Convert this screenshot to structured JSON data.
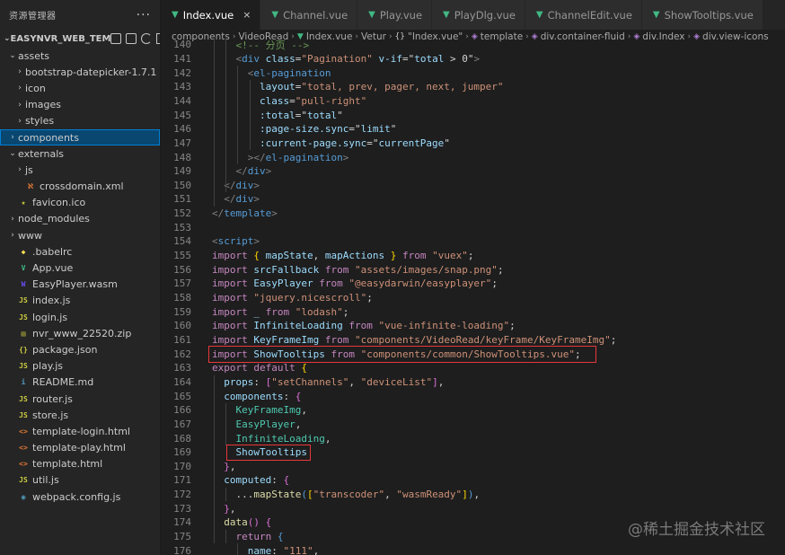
{
  "sidebar": {
    "title": "资源管理器",
    "more": "···",
    "project": "EASYNVR_WEB_TEM",
    "items": [
      {
        "label": "assets",
        "arrow": "⌄",
        "type": "folder-open",
        "indent": 1,
        "selected": false
      },
      {
        "label": "bootstrap-datepicker-1.7.1",
        "arrow": "›",
        "type": "folder",
        "indent": 2,
        "selected": false
      },
      {
        "label": "icon",
        "arrow": "›",
        "type": "folder",
        "indent": 2,
        "selected": false
      },
      {
        "label": "images",
        "arrow": "›",
        "type": "folder",
        "indent": 2,
        "selected": false
      },
      {
        "label": "styles",
        "arrow": "›",
        "type": "folder",
        "indent": 2,
        "selected": false
      },
      {
        "label": "components",
        "arrow": "›",
        "type": "folder",
        "indent": 1,
        "selected": true
      },
      {
        "label": "externals",
        "arrow": "⌄",
        "type": "folder-open",
        "indent": 1,
        "selected": false
      },
      {
        "label": "js",
        "arrow": "›",
        "type": "folder",
        "indent": 2,
        "selected": false
      },
      {
        "label": "crossdomain.xml",
        "arrow": "",
        "type": "xml",
        "indent": 2,
        "selected": false
      },
      {
        "label": "favicon.ico",
        "arrow": "",
        "type": "ico",
        "indent": 1,
        "selected": false
      },
      {
        "label": "node_modules",
        "arrow": "›",
        "type": "folder",
        "indent": 1,
        "selected": false
      },
      {
        "label": "www",
        "arrow": "›",
        "type": "folder",
        "indent": 1,
        "selected": false
      },
      {
        "label": ".babelrc",
        "arrow": "",
        "type": "babel",
        "indent": 1,
        "selected": false
      },
      {
        "label": "App.vue",
        "arrow": "",
        "type": "vue",
        "indent": 1,
        "selected": false
      },
      {
        "label": "EasyPlayer.wasm",
        "arrow": "",
        "type": "wasm",
        "indent": 1,
        "selected": false
      },
      {
        "label": "index.js",
        "arrow": "",
        "type": "js",
        "indent": 1,
        "selected": false
      },
      {
        "label": "login.js",
        "arrow": "",
        "type": "js",
        "indent": 1,
        "selected": false
      },
      {
        "label": "nvr_www_22520.zip",
        "arrow": "",
        "type": "zip",
        "indent": 1,
        "selected": false
      },
      {
        "label": "package.json",
        "arrow": "",
        "type": "json",
        "indent": 1,
        "selected": false
      },
      {
        "label": "play.js",
        "arrow": "",
        "type": "js",
        "indent": 1,
        "selected": false
      },
      {
        "label": "README.md",
        "arrow": "",
        "type": "md",
        "indent": 1,
        "selected": false
      },
      {
        "label": "router.js",
        "arrow": "",
        "type": "js",
        "indent": 1,
        "selected": false
      },
      {
        "label": "store.js",
        "arrow": "",
        "type": "js",
        "indent": 1,
        "selected": false
      },
      {
        "label": "template-login.html",
        "arrow": "",
        "type": "html",
        "indent": 1,
        "selected": false
      },
      {
        "label": "template-play.html",
        "arrow": "",
        "type": "html",
        "indent": 1,
        "selected": false
      },
      {
        "label": "template.html",
        "arrow": "",
        "type": "html",
        "indent": 1,
        "selected": false
      },
      {
        "label": "util.js",
        "arrow": "",
        "type": "js",
        "indent": 1,
        "selected": false
      },
      {
        "label": "webpack.config.js",
        "arrow": "",
        "type": "webpack",
        "indent": 1,
        "selected": false
      }
    ]
  },
  "tabs": [
    {
      "label": "Index.vue",
      "active": true,
      "close": "×"
    },
    {
      "label": "Channel.vue",
      "active": false,
      "close": ""
    },
    {
      "label": "Play.vue",
      "active": false,
      "close": ""
    },
    {
      "label": "PlayDlg.vue",
      "active": false,
      "close": ""
    },
    {
      "label": "ChannelEdit.vue",
      "active": false,
      "close": ""
    },
    {
      "label": "ShowTooltips.vue",
      "active": false,
      "close": ""
    }
  ],
  "breadcrumb": [
    "components",
    "VideoRead",
    "Index.vue",
    "Vetur",
    "\"Index.vue\"",
    "template",
    "div.container-fluid",
    "div.Index",
    "div.view-icons"
  ],
  "editor": {
    "lines": [
      {
        "n": "140",
        "t": [
          [
            "cmt",
            "    <!-- 分页 -->"
          ]
        ]
      },
      {
        "n": "141",
        "t": [
          [
            "tag",
            "    <"
          ],
          [
            "tn",
            "div"
          ],
          [
            "pl",
            " "
          ],
          [
            "attr",
            "class"
          ],
          [
            "pl",
            "="
          ],
          [
            "str",
            "\"Pagination\""
          ],
          [
            "pl",
            " "
          ],
          [
            "attr",
            "v-if"
          ],
          [
            "pl",
            "=\""
          ],
          [
            "var",
            "total"
          ],
          [
            "pl",
            " > 0\""
          ],
          [
            "tag",
            ">"
          ]
        ]
      },
      {
        "n": "142",
        "t": [
          [
            "tag",
            "      <"
          ],
          [
            "tn",
            "el-pagination"
          ]
        ]
      },
      {
        "n": "143",
        "t": [
          [
            "pl",
            "        "
          ],
          [
            "attr",
            "layout"
          ],
          [
            "pl",
            "="
          ],
          [
            "str",
            "\"total, prev, pager, next, jumper\""
          ]
        ]
      },
      {
        "n": "144",
        "t": [
          [
            "pl",
            "        "
          ],
          [
            "attr",
            "class"
          ],
          [
            "pl",
            "="
          ],
          [
            "str",
            "\"pull-right\""
          ]
        ]
      },
      {
        "n": "145",
        "t": [
          [
            "pl",
            "        "
          ],
          [
            "attr",
            ":total"
          ],
          [
            "pl",
            "=\""
          ],
          [
            "var",
            "total"
          ],
          [
            "pl",
            "\""
          ]
        ]
      },
      {
        "n": "146",
        "t": [
          [
            "pl",
            "        "
          ],
          [
            "attr",
            ":page-size.sync"
          ],
          [
            "pl",
            "=\""
          ],
          [
            "var",
            "limit"
          ],
          [
            "pl",
            "\""
          ]
        ]
      },
      {
        "n": "147",
        "t": [
          [
            "pl",
            "        "
          ],
          [
            "attr",
            ":current-page.sync"
          ],
          [
            "pl",
            "=\""
          ],
          [
            "var",
            "currentPage"
          ],
          [
            "pl",
            "\""
          ]
        ]
      },
      {
        "n": "148",
        "t": [
          [
            "tag",
            "      ></"
          ],
          [
            "tn",
            "el-pagination"
          ],
          [
            "tag",
            ">"
          ]
        ]
      },
      {
        "n": "149",
        "t": [
          [
            "tag",
            "    </"
          ],
          [
            "tn",
            "div"
          ],
          [
            "tag",
            ">"
          ]
        ]
      },
      {
        "n": "150",
        "t": [
          [
            "tag",
            "  </"
          ],
          [
            "tn",
            "div"
          ],
          [
            "tag",
            ">"
          ]
        ]
      },
      {
        "n": "151",
        "t": [
          [
            "tag",
            "  </"
          ],
          [
            "tn",
            "div"
          ],
          [
            "tag",
            ">"
          ]
        ]
      },
      {
        "n": "152",
        "t": [
          [
            "tag",
            "</"
          ],
          [
            "tn",
            "template"
          ],
          [
            "tag",
            ">"
          ]
        ]
      },
      {
        "n": "153",
        "t": []
      },
      {
        "n": "154",
        "t": [
          [
            "tag",
            "<"
          ],
          [
            "tn",
            "script"
          ],
          [
            "tag",
            ">"
          ]
        ]
      },
      {
        "n": "155",
        "t": [
          [
            "kw",
            "import"
          ],
          [
            "pl",
            " "
          ],
          [
            "yl",
            "{"
          ],
          [
            "pl",
            " "
          ],
          [
            "var",
            "mapState"
          ],
          [
            "pl",
            ", "
          ],
          [
            "var",
            "mapActions"
          ],
          [
            "pl",
            " "
          ],
          [
            "yl",
            "}"
          ],
          [
            "pl",
            " "
          ],
          [
            "kw",
            "from"
          ],
          [
            "pl",
            " "
          ],
          [
            "str",
            "\"vuex\""
          ],
          [
            "pl",
            ";"
          ]
        ]
      },
      {
        "n": "156",
        "t": [
          [
            "kw",
            "import"
          ],
          [
            "pl",
            " "
          ],
          [
            "var",
            "srcFallback"
          ],
          [
            "pl",
            " "
          ],
          [
            "kw",
            "from"
          ],
          [
            "pl",
            " "
          ],
          [
            "str",
            "\"assets/images/snap.png\""
          ],
          [
            "pl",
            ";"
          ]
        ]
      },
      {
        "n": "157",
        "t": [
          [
            "kw",
            "import"
          ],
          [
            "pl",
            " "
          ],
          [
            "var",
            "EasyPlayer"
          ],
          [
            "pl",
            " "
          ],
          [
            "kw",
            "from"
          ],
          [
            "pl",
            " "
          ],
          [
            "str",
            "\"@easydarwin/easyplayer\""
          ],
          [
            "pl",
            ";"
          ]
        ]
      },
      {
        "n": "158",
        "t": [
          [
            "kw",
            "import"
          ],
          [
            "pl",
            " "
          ],
          [
            "str",
            "\"jquery.nicescroll\""
          ],
          [
            "pl",
            ";"
          ]
        ]
      },
      {
        "n": "159",
        "t": [
          [
            "kw",
            "import"
          ],
          [
            "pl",
            " "
          ],
          [
            "var",
            "_"
          ],
          [
            "pl",
            " "
          ],
          [
            "kw",
            "from"
          ],
          [
            "pl",
            " "
          ],
          [
            "str",
            "\"lodash\""
          ],
          [
            "pl",
            ";"
          ]
        ]
      },
      {
        "n": "160",
        "t": [
          [
            "kw",
            "import"
          ],
          [
            "pl",
            " "
          ],
          [
            "var",
            "InfiniteLoading"
          ],
          [
            "pl",
            " "
          ],
          [
            "kw",
            "from"
          ],
          [
            "pl",
            " "
          ],
          [
            "str",
            "\"vue-infinite-loading\""
          ],
          [
            "pl",
            ";"
          ]
        ]
      },
      {
        "n": "161",
        "t": [
          [
            "kw",
            "import"
          ],
          [
            "pl",
            " "
          ],
          [
            "var",
            "KeyFrameImg"
          ],
          [
            "pl",
            " "
          ],
          [
            "kw",
            "from"
          ],
          [
            "pl",
            " "
          ],
          [
            "str",
            "\"components/VideoRead/keyFrame/KeyFrameImg\""
          ],
          [
            "pl",
            ";"
          ]
        ]
      },
      {
        "n": "162",
        "t": [
          [
            "kw",
            "import"
          ],
          [
            "pl",
            " "
          ],
          [
            "var",
            "ShowTooltips"
          ],
          [
            "pl",
            " "
          ],
          [
            "kw",
            "from"
          ],
          [
            "pl",
            " "
          ],
          [
            "str",
            "\"components/common/ShowTooltips.vue\""
          ],
          [
            "pl",
            ";"
          ]
        ]
      },
      {
        "n": "163",
        "t": [
          [
            "kw",
            "export"
          ],
          [
            "pl",
            " "
          ],
          [
            "kw",
            "default"
          ],
          [
            "pl",
            " "
          ],
          [
            "yl",
            "{"
          ]
        ]
      },
      {
        "n": "164",
        "t": [
          [
            "pl",
            "  "
          ],
          [
            "var",
            "props"
          ],
          [
            "pl",
            ": "
          ],
          [
            "pk",
            "["
          ],
          [
            "str",
            "\"setChannels\""
          ],
          [
            "pl",
            ", "
          ],
          [
            "str",
            "\"deviceList\""
          ],
          [
            "pk",
            "]"
          ],
          [
            "pl",
            ","
          ]
        ]
      },
      {
        "n": "165",
        "t": [
          [
            "pl",
            "  "
          ],
          [
            "var",
            "components"
          ],
          [
            "pl",
            ": "
          ],
          [
            "pk",
            "{"
          ]
        ]
      },
      {
        "n": "166",
        "t": [
          [
            "pl",
            "    "
          ],
          [
            "teal",
            "KeyFrameImg"
          ],
          [
            "pl",
            ","
          ]
        ]
      },
      {
        "n": "167",
        "t": [
          [
            "pl",
            "    "
          ],
          [
            "teal",
            "EasyPlayer"
          ],
          [
            "pl",
            ","
          ]
        ]
      },
      {
        "n": "168",
        "t": [
          [
            "pl",
            "    "
          ],
          [
            "teal",
            "InfiniteLoading"
          ],
          [
            "pl",
            ","
          ]
        ]
      },
      {
        "n": "169",
        "t": [
          [
            "pl",
            "    "
          ],
          [
            "var",
            "ShowTooltips"
          ]
        ]
      },
      {
        "n": "170",
        "t": [
          [
            "pl",
            "  "
          ],
          [
            "pk",
            "}"
          ],
          [
            "pl",
            ","
          ]
        ]
      },
      {
        "n": "171",
        "t": [
          [
            "pl",
            "  "
          ],
          [
            "var",
            "computed"
          ],
          [
            "pl",
            ": "
          ],
          [
            "pk",
            "{"
          ]
        ]
      },
      {
        "n": "172",
        "t": [
          [
            "pl",
            "    ..."
          ],
          [
            "fn",
            "mapState"
          ],
          [
            "bl",
            "("
          ],
          [
            "yl",
            "["
          ],
          [
            "str",
            "\"transcoder\""
          ],
          [
            "pl",
            ", "
          ],
          [
            "str",
            "\"wasmReady\""
          ],
          [
            "yl",
            "]"
          ],
          [
            "bl",
            ")"
          ],
          [
            "pl",
            ","
          ]
        ]
      },
      {
        "n": "173",
        "t": [
          [
            "pl",
            "  "
          ],
          [
            "pk",
            "}"
          ],
          [
            "pl",
            ","
          ]
        ]
      },
      {
        "n": "174",
        "t": [
          [
            "pl",
            "  "
          ],
          [
            "fn",
            "data"
          ],
          [
            "pk",
            "()"
          ],
          [
            "pl",
            " "
          ],
          [
            "pk",
            "{"
          ]
        ]
      },
      {
        "n": "175",
        "t": [
          [
            "pl",
            "    "
          ],
          [
            "kw",
            "return"
          ],
          [
            "pl",
            " "
          ],
          [
            "bl",
            "{"
          ]
        ]
      },
      {
        "n": "176",
        "t": [
          [
            "pl",
            "      "
          ],
          [
            "var",
            "name"
          ],
          [
            "pl",
            ": "
          ],
          [
            "str",
            "\"111\""
          ],
          [
            "pl",
            ","
          ]
        ]
      }
    ]
  },
  "watermark": "@稀土掘金技术社区",
  "colors": {
    "accent": "#007fd4",
    "highlight_box": "#e8373b",
    "vue_green": "#41b883"
  }
}
